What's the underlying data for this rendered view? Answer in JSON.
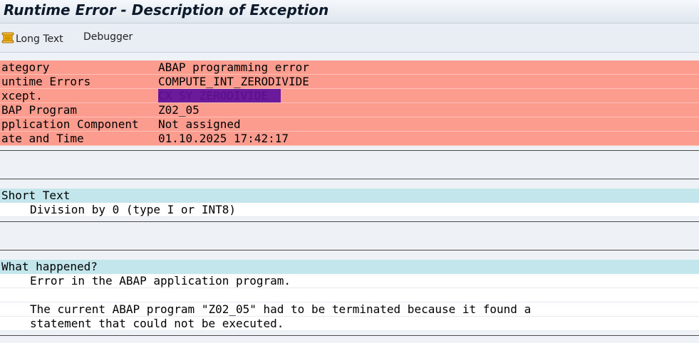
{
  "window": {
    "title": "Runtime Error - Description of Exception"
  },
  "toolbar": {
    "long_text_icon": "scroll-icon",
    "long_text_label": "Long Text",
    "debugger_label": "Debugger"
  },
  "header_fields": [
    {
      "key": "ategory",
      "value": "ABAP programming error"
    },
    {
      "key": "untime Errors",
      "value": "COMPUTE_INT_ZERODIVIDE"
    },
    {
      "key": "xcept.",
      "value": "CX_SY_ZERODIVIDE"
    },
    {
      "key": "BAP Program",
      "value": "Z02_05"
    },
    {
      "key": "pplication Component",
      "value": "Not assigned"
    },
    {
      "key": "ate and Time",
      "value": "01.10.2025 17:42:17"
    }
  ],
  "short_text": {
    "title": "Short Text",
    "lines": [
      "Division by 0 (type I or INT8)"
    ]
  },
  "what_happened": {
    "title": "What happened?",
    "lines": [
      "Error in the ABAP application program.",
      "",
      "The current ABAP program \"Z02_05\" had to be terminated because it found a",
      "statement that could not be executed."
    ]
  },
  "colors": {
    "header_bg": "#fc9c8e",
    "section_title_bg": "#c2e6eb",
    "selection": "#6a1a9a"
  }
}
